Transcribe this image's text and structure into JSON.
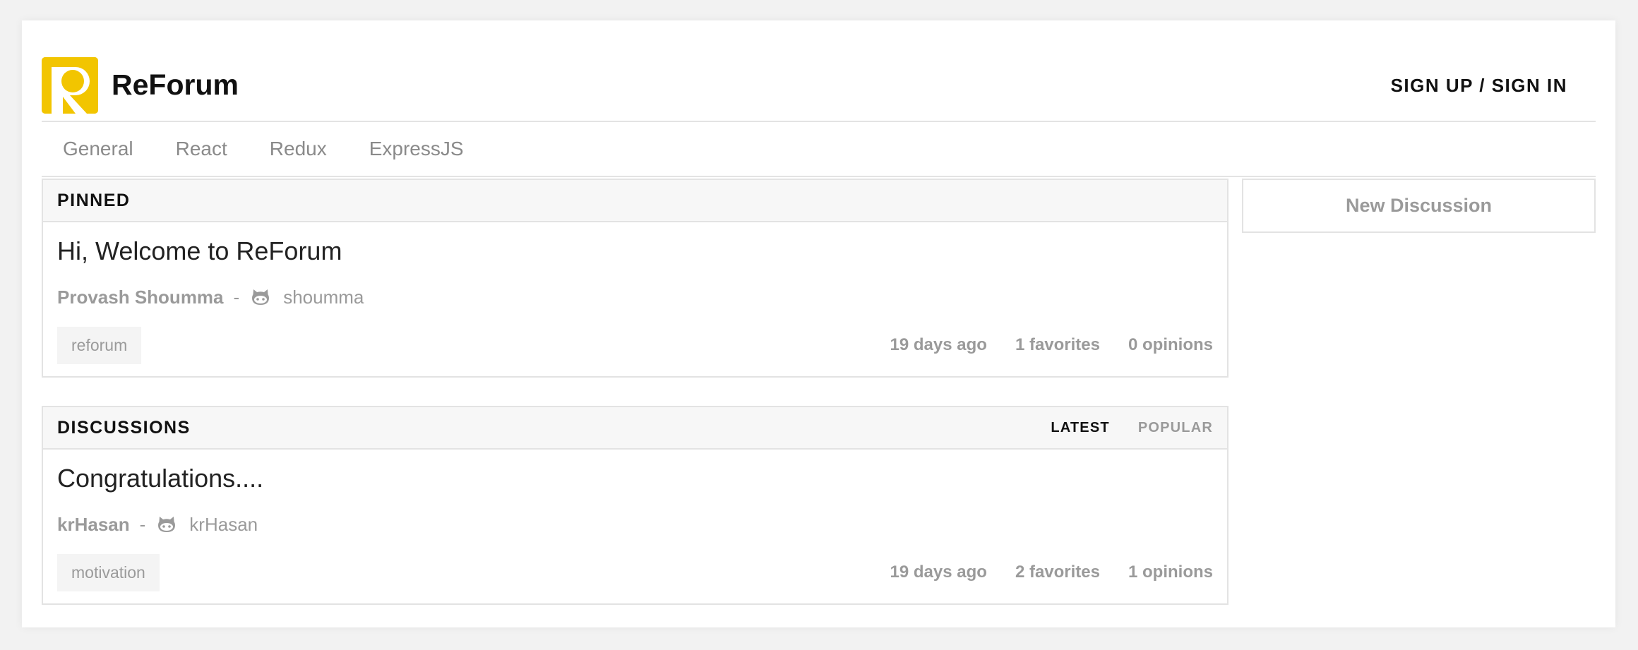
{
  "header": {
    "brand": "ReForum",
    "signin_label": "SIGN UP / SIGN IN",
    "logo_color": "#f2c500"
  },
  "categories": [
    "General",
    "React",
    "Redux",
    "ExpressJS"
  ],
  "pinned": {
    "title": "PINNED",
    "items": [
      {
        "title": "Hi, Welcome to ReForum",
        "author": "Provash Shoumma",
        "separator": "-",
        "handle": "shoumma",
        "handle_icon": "github-icon",
        "tag": "reforum",
        "time": "19 days ago",
        "favorites": "1 favorites",
        "opinions": "0 opinions"
      }
    ]
  },
  "discussions": {
    "title": "DISCUSSIONS",
    "sort_latest": "LATEST",
    "sort_popular": "POPULAR",
    "items": [
      {
        "title": "Congratulations....",
        "author": "krHasan",
        "separator": "-",
        "handle": "krHasan",
        "handle_icon": "github-icon",
        "tag": "motivation",
        "time": "19 days ago",
        "favorites": "2 favorites",
        "opinions": "1 opinions"
      }
    ]
  },
  "sidebar": {
    "new_discussion_label": "New Discussion"
  }
}
